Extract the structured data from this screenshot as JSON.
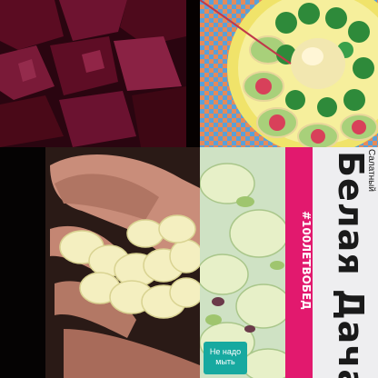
{
  "collage": {
    "tiles": [
      {
        "name": "beet-cubes",
        "description_icon": "beet-cubes-photo"
      },
      {
        "name": "salad-plate",
        "description_icon": "salad-plate-photo"
      },
      {
        "name": "hand-cauliflower",
        "description_icon": "hand-photo"
      },
      {
        "name": "lettuce-package",
        "description_icon": "package-photo"
      }
    ]
  },
  "package": {
    "brand": "Белая Дача",
    "hashtag": "#100ЛЕТВОБЕД",
    "top_label": "Салатный",
    "badge": "Не надо мыть"
  },
  "colors": {
    "beet": "#4a0a1a",
    "plate_rim": "#f0e36a",
    "package_pink": "#e2196e",
    "badge_teal": "#17a9a0"
  }
}
